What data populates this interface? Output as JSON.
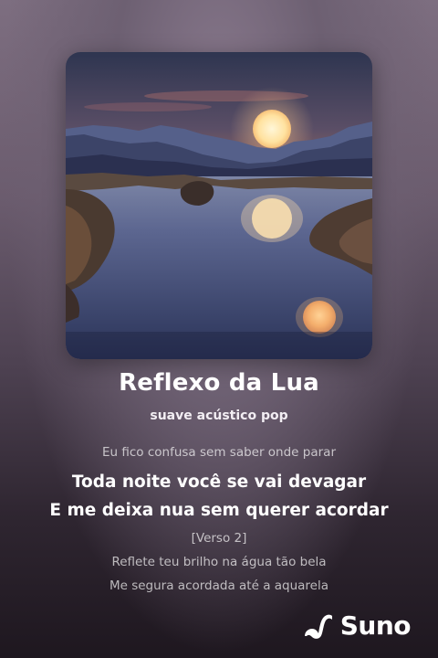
{
  "artwork": {
    "icon": "moon-lake-landscape-artwork"
  },
  "song": {
    "title": "Reflexo da Lua",
    "style": "suave acústico pop"
  },
  "lyrics": [
    {
      "text": "Eu fico confusa sem saber onde parar",
      "state": "past"
    },
    {
      "text": "Toda noite você se vai devagar",
      "state": "current"
    },
    {
      "text": "E me deixa nua sem querer acordar",
      "state": "current"
    },
    {
      "text": "[Verso 2]",
      "state": "upcoming"
    },
    {
      "text": "Reflete teu brilho na água tão bela",
      "state": "upcoming"
    },
    {
      "text": "Me segura acordada até a aquarela",
      "state": "upcoming"
    }
  ],
  "brand": {
    "name": "Suno",
    "icon": "suno-logo-icon"
  }
}
